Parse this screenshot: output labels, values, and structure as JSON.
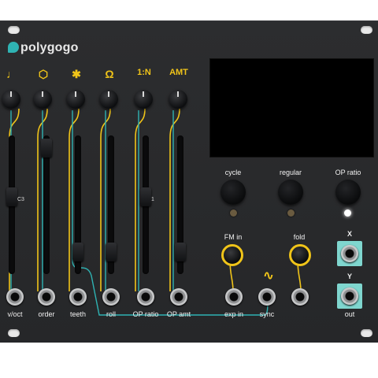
{
  "brand": {
    "name": "polygogo"
  },
  "top_labels": [
    "1:N",
    "AMT"
  ],
  "top_icons": [
    "note-icon",
    "polygon-icon",
    "star-icon",
    "loop-icon",
    "ratio-label",
    "amount-label"
  ],
  "buttons": {
    "cycle": "cycle",
    "regular": "regular",
    "op_ratio": "OP ratio"
  },
  "knob_labels": {
    "fm_in": "FM in",
    "fold": "fold"
  },
  "jack_labels": [
    "v/oct",
    "order",
    "teeth",
    "roll",
    "OP ratio",
    "OP amt",
    "exp in",
    "sync",
    "out"
  ],
  "xy": {
    "x": "X",
    "y": "Y"
  },
  "slider_marks": {
    "c3": "C3",
    "one": "1"
  },
  "colors": {
    "accent_yellow": "#f0c419",
    "accent_teal": "#7fd6cf",
    "panel": "#2a2b2d"
  }
}
